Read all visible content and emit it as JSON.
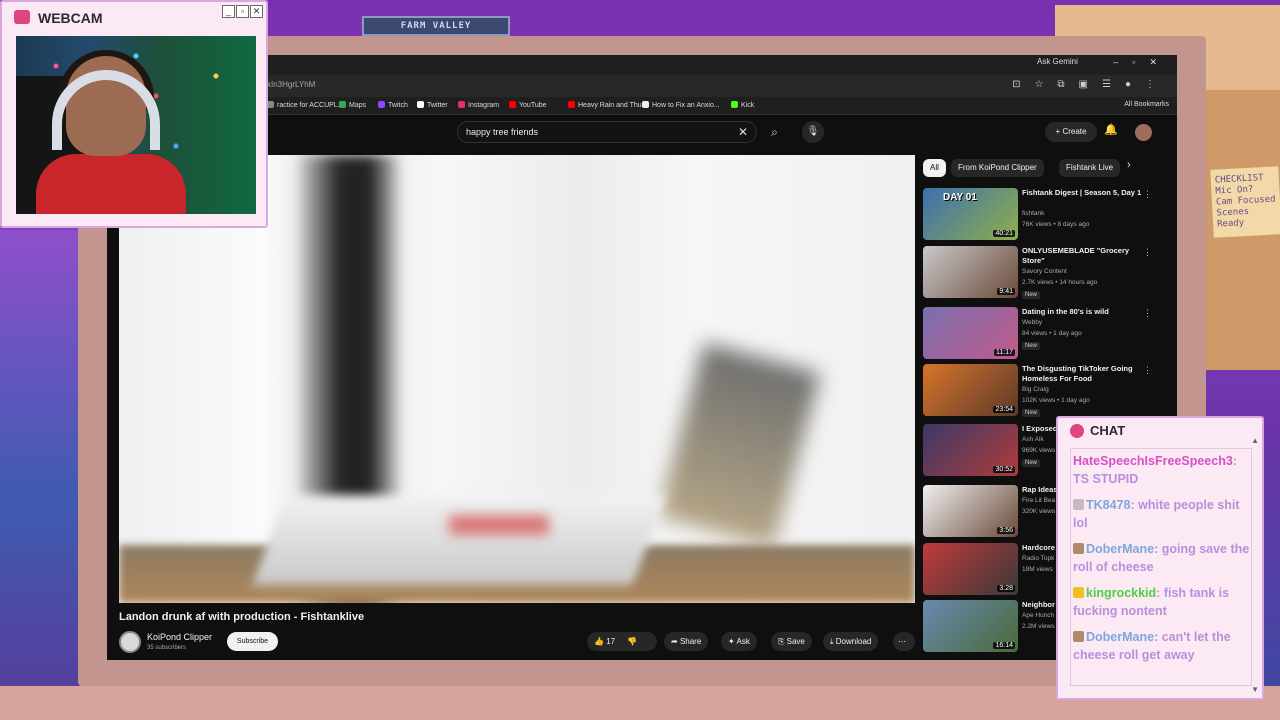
{
  "scene": {
    "sign_text": "FARM VALLEY",
    "note_lines": [
      "CHECKLIST",
      "Mic On?",
      "Cam Focused",
      "Scenes Ready"
    ]
  },
  "browser": {
    "ask_gemini": "Ask Gemini",
    "url_fragment": "kIn3HgrLYhM",
    "bookmarks": [
      {
        "label": "ractice for ACCUPL...",
        "color": "#888888"
      },
      {
        "label": "Maps",
        "color": "#34a853"
      },
      {
        "label": "Twitch",
        "color": "#9146ff"
      },
      {
        "label": "Twitter",
        "color": "#ffffff"
      },
      {
        "label": "Instagram",
        "color": "#e1306c"
      },
      {
        "label": "YouTube",
        "color": "#ff0000"
      },
      {
        "label": "Heavy Rain and Thu...",
        "color": "#ff0000"
      },
      {
        "label": "How to Fix an Anxio...",
        "color": "#eeeeee"
      },
      {
        "label": "Kick",
        "color": "#53fc18"
      }
    ],
    "all_bookmarks": "All Bookmarks"
  },
  "youtube": {
    "search_query": "happy tree friends",
    "create_label": "Create",
    "video_title": "Landon drunk af with production - Fishtanklive",
    "channel_name": "KoiPond Clipper",
    "channel_subs": "35 subscribers",
    "subscribe_label": "Subscribe",
    "like_count": "17",
    "share_label": "Share",
    "ask_label": "Ask",
    "save_label": "Save",
    "download_label": "Download",
    "chips": [
      "All",
      "From KoiPond Clipper",
      "Fishtank Live"
    ],
    "recommendations": [
      {
        "title": "Fishtank Digest | Season 5, Day 1",
        "channel": "fishtank",
        "meta": "76K views • 8 days ago",
        "duration": "40:21",
        "new": "",
        "thumb_overlay": "DAY 01",
        "colors": [
          "#3b6fb0",
          "#8fb04a"
        ]
      },
      {
        "title": "ONLYUSEMEBLADE \"Grocery Store\"",
        "channel": "Savory Content",
        "meta": "2.7K views • 14 hours ago",
        "duration": "9:41",
        "new": "New",
        "thumb_overlay": "",
        "colors": [
          "#c9c9c9",
          "#6b4a3a"
        ]
      },
      {
        "title": "Dating in the 80's is wild",
        "channel": "Webby",
        "meta": "84 views • 1 day ago",
        "duration": "11:17",
        "new": "New",
        "thumb_overlay": "",
        "colors": [
          "#7a6fb0",
          "#c05a8a"
        ]
      },
      {
        "title": "The Disgusting TikToker Going Homeless For Food",
        "channel": "Big Craig",
        "meta": "102K views • 1 day ago",
        "duration": "23:54",
        "new": "New",
        "thumb_overlay": "",
        "colors": [
          "#d8742a",
          "#5a3a2a"
        ]
      },
      {
        "title": "I Exposed Ranch...",
        "channel": "Ash Alk",
        "meta": "969K views",
        "duration": "30:52",
        "new": "New",
        "thumb_overlay": "",
        "colors": [
          "#3a3a6a",
          "#b03a3a"
        ]
      },
      {
        "title": "Rap Ideas",
        "channel": "Fire Lit Bea",
        "meta": "320K views",
        "duration": "3:56",
        "new": "",
        "thumb_overlay": "",
        "colors": [
          "#f0f0f0",
          "#6a4a3a"
        ]
      },
      {
        "title": "Hardcore losing epi",
        "channel": "Radio Topk",
        "meta": "18M views",
        "duration": "3:28",
        "new": "",
        "thumb_overlay": "",
        "colors": [
          "#c03a3a",
          "#3a3a3a"
        ]
      },
      {
        "title": "Neighbor Riddled W",
        "channel": "Ape Hunch",
        "meta": "2.2M views",
        "duration": "16:14",
        "new": "",
        "thumb_overlay": "",
        "colors": [
          "#6a8ab0",
          "#4a6a3a"
        ]
      }
    ]
  },
  "webcam": {
    "label": "WEBCAM"
  },
  "chat": {
    "label": "CHAT",
    "messages": [
      {
        "user": "HateSpeechIsFreeSpeech3",
        "text": ": TS STUPID",
        "badge": "none",
        "user_color": "#d94fc8"
      },
      {
        "user": "TK8478",
        "text": ": white people shit lol",
        "badge": "rabbit",
        "user_color": "#7fa6dc"
      },
      {
        "user": "DoberMane",
        "text": ": going save the roll of cheese",
        "badge": "dog",
        "user_color": "#7fa6dc"
      },
      {
        "user": "kingrockkid",
        "text": ": fish tank is fucking nontent",
        "badge": "crown",
        "user_color": "#4fcf3f"
      },
      {
        "user": "DoberMane",
        "text": ": can't let the cheese roll get away",
        "badge": "dog",
        "user_color": "#7fa6dc"
      }
    ]
  }
}
